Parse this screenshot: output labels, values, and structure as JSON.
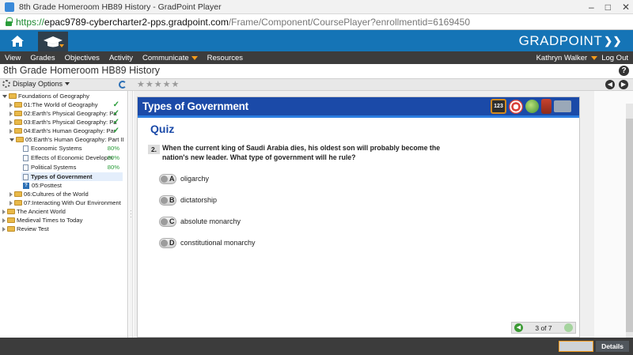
{
  "window": {
    "title": "8th Grade Homeroom HB89 History - GradPoint Player"
  },
  "address": {
    "scheme": "https://",
    "host": "epac9789-cybercharter2-pps.gradpoint.com",
    "path": "/Frame/Component/CoursePlayer?enrollmentid=6169450"
  },
  "banner": {
    "logo": "GRADPOINT"
  },
  "menu": {
    "items": [
      "View",
      "Grades",
      "Objectives",
      "Activity",
      "Communicate",
      "Resources"
    ],
    "user": "Kathryn Walker",
    "logout": "Log Out"
  },
  "course": {
    "title": "8th Grade Homeroom HB89 History"
  },
  "toolbar": {
    "display_options": "Display Options"
  },
  "tree": {
    "root": "Foundations of Geography",
    "units": [
      {
        "label": "01:The World of Geography",
        "status": "check"
      },
      {
        "label": "02:Earth's Physical Geography: Pa",
        "status": "check"
      },
      {
        "label": "03:Earth's Physical Geography: Pa",
        "status": "check"
      },
      {
        "label": "04:Earth's Human Geography: Par",
        "status": "check"
      },
      {
        "label": "05:Earth's Human Geography: Part II",
        "status": ""
      }
    ],
    "lessons": [
      {
        "label": "Economic Systems",
        "pct": "80%"
      },
      {
        "label": "Effects of Economic Developm",
        "pct": "80%"
      },
      {
        "label": "Political Systems",
        "pct": "80%"
      },
      {
        "label": "Types of Government",
        "pct": ""
      }
    ],
    "posttest": "05:Posttest",
    "more_units": [
      "06:Cultures of the World",
      "07:Interacting With Our Environment"
    ],
    "other_courses": [
      "The Ancient World",
      "Medieval Times to Today",
      "Review Test"
    ]
  },
  "activity": {
    "title": "Types of Government",
    "calc_label": "123",
    "section": "Quiz",
    "question_number": "2.",
    "question": "When the current king of Saudi Arabia dies, his oldest son will probably become the nation's new leader. What type of government will he rule?",
    "options": [
      {
        "letter": "A",
        "text": "oligarchy"
      },
      {
        "letter": "B",
        "text": "dictatorship"
      },
      {
        "letter": "C",
        "text": "absolute monarchy"
      },
      {
        "letter": "D",
        "text": "constitutional monarchy"
      }
    ],
    "pager": "3 of 7"
  },
  "footer": {
    "details": "Details"
  }
}
